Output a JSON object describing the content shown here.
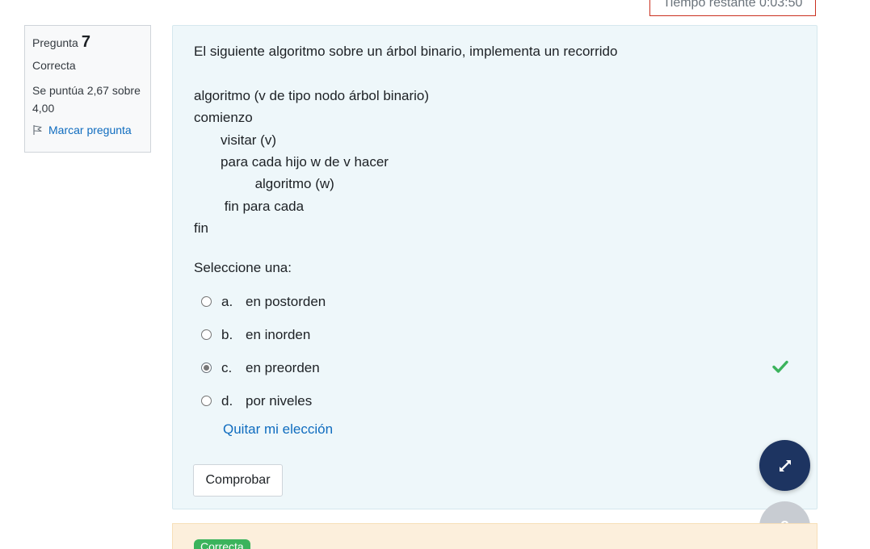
{
  "timer": {
    "text": "Tiempo restante 0:03:50"
  },
  "question_info": {
    "label": "Pregunta",
    "number": "7",
    "state": "Correcta",
    "grade": "Se puntúa 2,67 sobre 4,00",
    "flag_label": "Marcar pregunta"
  },
  "question": {
    "lines": [
      "El siguiente algoritmo sobre un árbol binario, implementa un recorrido",
      "",
      "algoritmo (v de tipo nodo árbol binario)",
      "comienzo",
      "       visitar (v)",
      "       para cada hijo w de v hacer",
      "                algoritmo (w)",
      "        fin para cada",
      "fin"
    ],
    "prompt": "Seleccione una:",
    "options": [
      {
        "letter": "a.",
        "text": "en postorden",
        "checked": false
      },
      {
        "letter": "b.",
        "text": "en inorden",
        "checked": false
      },
      {
        "letter": "c.",
        "text": "en preorden",
        "checked": true
      },
      {
        "letter": "d.",
        "text": "por niveles",
        "checked": false
      }
    ],
    "clear_label": "Quitar mi elección",
    "check_button": "Comprobar"
  },
  "feedback": {
    "badge": "Correcta"
  },
  "help_fab": {
    "label": "?"
  },
  "colors": {
    "correct_green": "#3bb35c",
    "link_blue": "#0f6cbf",
    "timer_border": "#ca3120",
    "fab_dark": "#1d3461"
  }
}
